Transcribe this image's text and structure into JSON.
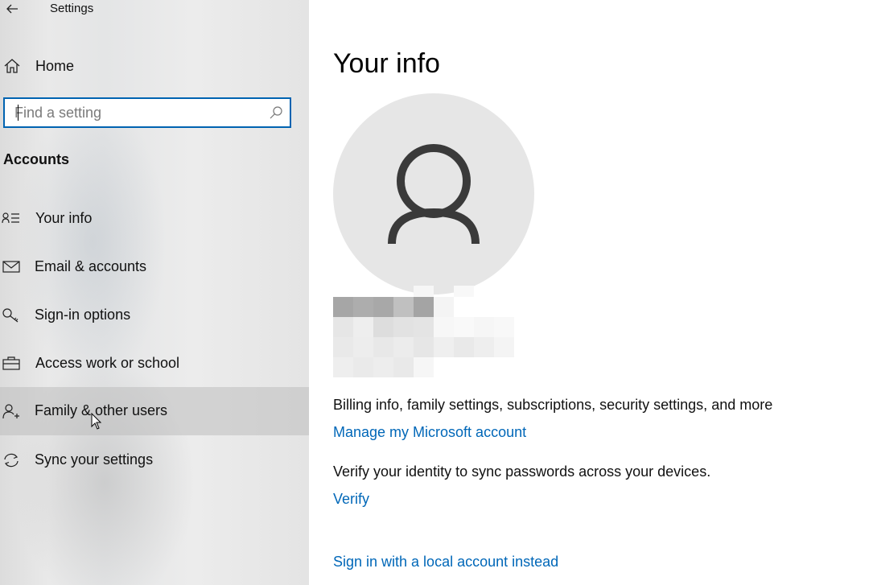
{
  "window": {
    "title": "Settings"
  },
  "sidebar": {
    "home_label": "Home",
    "search": {
      "placeholder": "Find a setting",
      "value": ""
    },
    "section_heading": "Accounts",
    "items": [
      {
        "label": "Your info",
        "icon": "contact-info-icon"
      },
      {
        "label": "Email & accounts",
        "icon": "mail-icon"
      },
      {
        "label": "Sign-in options",
        "icon": "key-icon"
      },
      {
        "label": "Access work or school",
        "icon": "briefcase-icon"
      },
      {
        "label": "Family & other users",
        "icon": "add-user-icon",
        "hovered": true
      },
      {
        "label": "Sync your settings",
        "icon": "sync-icon"
      }
    ]
  },
  "main": {
    "title": "Your info",
    "account_description": "Billing info, family settings, subscriptions, security settings, and more",
    "manage_link": "Manage my Microsoft account",
    "verify_description": "Verify your identity to sync passwords across your devices.",
    "verify_link": "Verify",
    "local_account_link": "Sign in with a local account instead"
  },
  "colors": {
    "accent": "#0063b1",
    "link": "#0067b8",
    "avatar_bg": "#e6e6e6",
    "avatar_glyph": "#3a3a3a"
  }
}
